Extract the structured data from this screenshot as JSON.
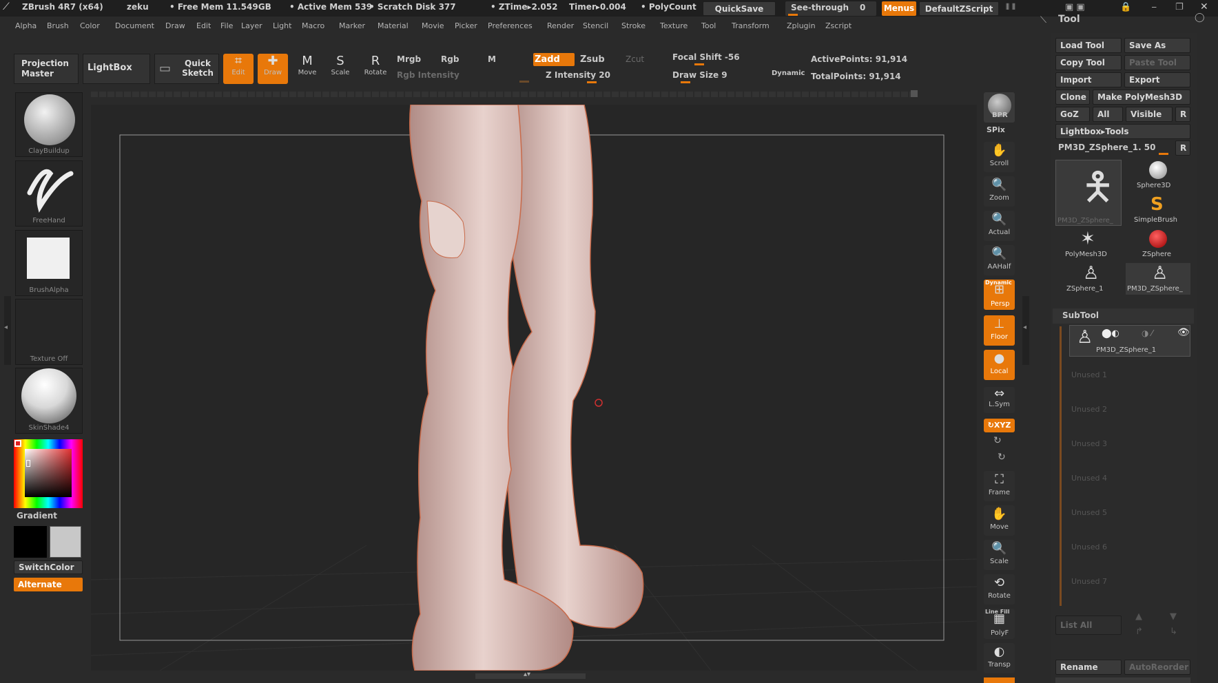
{
  "titlebar": {
    "app": "ZBrush 4R7 (x64)",
    "user": "zeku",
    "free_mem": "• Free Mem 11.549GB",
    "active_mem": "• Active Mem 539",
    "scratch": "• Scratch Disk 377",
    "ztime": "• ZTime▸2.052",
    "timer": "Timer▸0.004",
    "polycount": "• PolyCount",
    "quicksave": "QuickSave",
    "see_through_label": "See-through",
    "see_through_value": "0",
    "menus": "Menus",
    "script": "DefaultZScript"
  },
  "menubar": [
    "Alpha",
    "Brush",
    "Color",
    "Document",
    "Draw",
    "Edit",
    "File",
    "Layer",
    "Light",
    "Macro",
    "Marker",
    "Material",
    "Movie",
    "Picker",
    "Preferences",
    "Render",
    "Stencil",
    "Stroke",
    "Texture",
    "Tool",
    "Transform",
    "Zplugin",
    "Zscript"
  ],
  "shelf": {
    "projection_master": "Projection Master",
    "lightbox": "LightBox",
    "quick_sketch": "Quick Sketch",
    "edit": "Edit",
    "draw": "Draw",
    "move": "Move",
    "scale": "Scale",
    "rotate": "Rotate",
    "mrgb": "Mrgb",
    "rgb": "Rgb",
    "m": "M",
    "rgb_intensity": "Rgb Intensity",
    "zadd": "Zadd",
    "zsub": "Zsub",
    "zcut": "Zcut",
    "z_intensity": "Z Intensity 20",
    "focal_shift": "Focal Shift -56",
    "draw_size": "Draw Size 9",
    "dynamic": "Dynamic",
    "active_points": "ActivePoints: 91,914",
    "total_points": "TotalPoints: 91,914"
  },
  "left": {
    "brush": "ClayBuildup",
    "stroke": "FreeHand",
    "alpha": "BrushAlpha",
    "texture": "Texture Off",
    "material": "SkinShade4",
    "gradient": "Gradient",
    "switchcolor": "SwitchColor",
    "alternate": "Alternate"
  },
  "right_tools": {
    "bpr": "BPR",
    "spix": "SPix",
    "scroll": "Scroll",
    "zoom": "Zoom",
    "actual": "Actual",
    "aahalf": "AAHalf",
    "dynamic": "Dynamic",
    "persp": "Persp",
    "floor": "Floor",
    "local": "Local",
    "lsym": "L.Sym",
    "xyz": "↻XYZ",
    "frame": "Frame",
    "move": "Move",
    "scale": "Scale",
    "rotate": "Rotate",
    "line_fill": "Line Fill",
    "polyf": "PolyF",
    "transp": "Transp"
  },
  "tool_palette": {
    "title": "Tool",
    "load_tool": "Load Tool",
    "save_as": "Save As",
    "copy_tool": "Copy Tool",
    "paste_tool": "Paste Tool",
    "import": "Import",
    "export": "Export",
    "clone": "Clone",
    "make_polymesh": "Make PolyMesh3D",
    "goz": "GoZ",
    "all": "All",
    "visible": "Visible",
    "r": "R",
    "lightbox_tools": "Lightbox▸Tools",
    "current_tool": "PM3D_ZSphere_1. 50",
    "thumbs": [
      "PM3D_ZSphere_",
      "Sphere3D",
      "SimpleBrush",
      "PolyMesh3D",
      "ZSphere",
      "ZSphere_1",
      "PM3D_ZSphere_"
    ],
    "subtool_title": "SubTool",
    "subtool_name": "PM3D_ZSphere_1",
    "unused": [
      "Unused 1",
      "Unused 2",
      "Unused 3",
      "Unused 4",
      "Unused 5",
      "Unused 6",
      "Unused 7"
    ],
    "list_all": "List All",
    "rename": "Rename",
    "autoreorder": "AutoReorder"
  },
  "colors": {
    "accent": "#e8780a",
    "panel": "#2b2b2b",
    "viewport": "#262626"
  }
}
